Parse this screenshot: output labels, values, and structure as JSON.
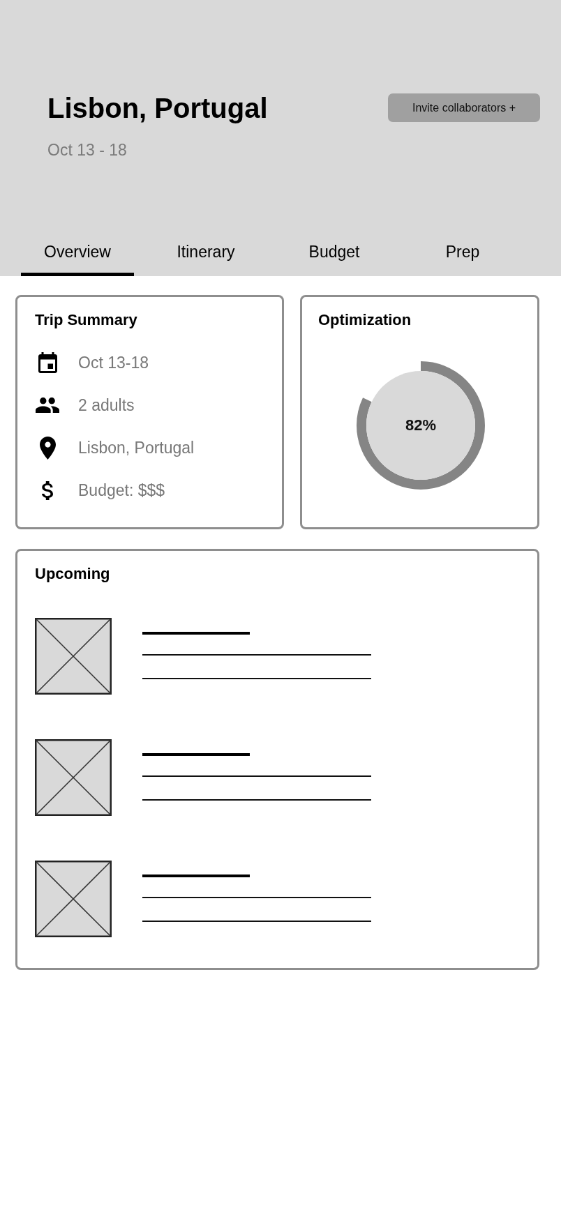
{
  "header": {
    "title": "Lisbon, Portugal",
    "dates": "Oct 13 - 18",
    "invite_button": "Invite collaborators +"
  },
  "tabs": [
    {
      "label": "Overview",
      "selected": true
    },
    {
      "label": "Itinerary",
      "selected": false
    },
    {
      "label": "Budget",
      "selected": false
    },
    {
      "label": "Prep",
      "selected": false
    }
  ],
  "trip_summary": {
    "title": "Trip Summary",
    "rows": [
      {
        "kind": "date",
        "text": "Oct 13-18"
      },
      {
        "kind": "travelers",
        "text": "2 adults"
      },
      {
        "kind": "location",
        "text": "Lisbon, Portugal"
      },
      {
        "kind": "budget",
        "text": "Budget: $$$"
      }
    ]
  },
  "optimization": {
    "title": "Optimization",
    "level": 0.82,
    "reading": "82%"
  },
  "upcoming": {
    "title": "Upcoming",
    "items": [
      {
        "kind": "placeholder"
      },
      {
        "kind": "placeholder"
      },
      {
        "kind": "placeholder"
      }
    ]
  }
}
